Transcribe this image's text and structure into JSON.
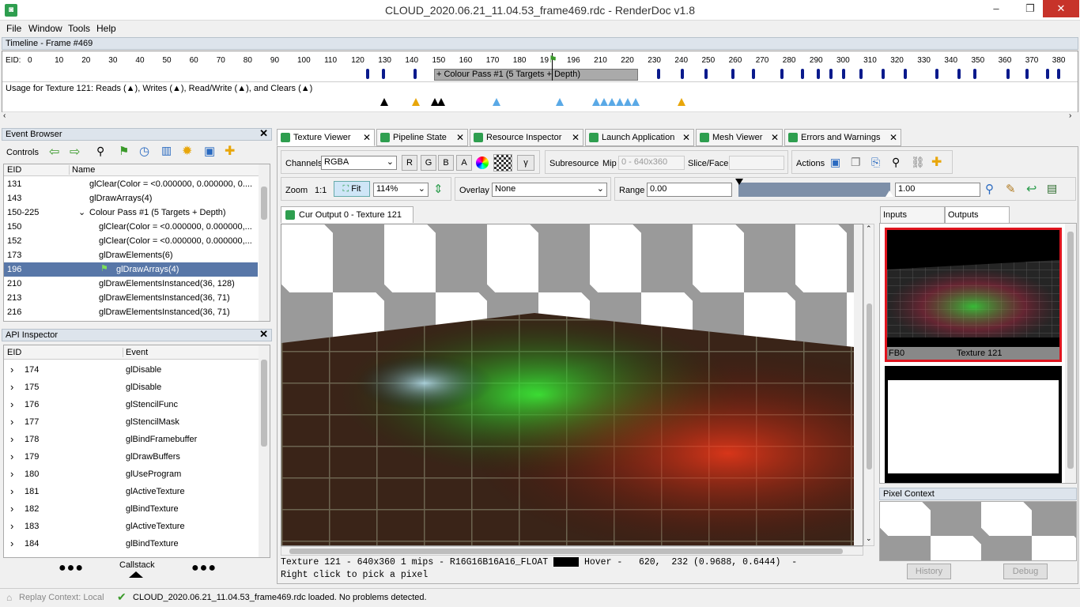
{
  "window": {
    "title": "CLOUD_2020.06.21_11.04.53_frame469.rdc - RenderDoc v1.8",
    "minimize": "–",
    "maximize": "❐",
    "close": "✕"
  },
  "menu": [
    "File",
    "Window",
    "Tools",
    "Help"
  ],
  "timeline": {
    "header": "Timeline - Frame #469",
    "eid_label": "EID:",
    "ticks": [
      "0",
      "10",
      "20",
      "30",
      "40",
      "50",
      "60",
      "70",
      "80",
      "90",
      "100",
      "110",
      "120",
      "130",
      "140",
      "150",
      "160",
      "170",
      "180",
      "19",
      "196",
      "210",
      "220",
      "230",
      "240",
      "250",
      "260",
      "270",
      "280",
      "290",
      "300",
      "310",
      "320",
      "330",
      "340",
      "350",
      "360",
      "370",
      "380"
    ],
    "pass_label": "+ Colour Pass #1 (5 Targets + Depth)",
    "usage_text": "Usage for Texture 121: Reads (▲), Writes (▲), Read/Write (▲), and Clears (▲)"
  },
  "event_browser": {
    "header": "Event Browser",
    "controls_label": "Controls",
    "columns": [
      "EID",
      "Name"
    ],
    "rows": [
      {
        "eid": "131",
        "name": "glClear(Color = <0.000000, 0.000000, 0...."
      },
      {
        "eid": "143",
        "name": "glDrawArrays(4)"
      },
      {
        "eid": "150-225",
        "name": "Colour Pass #1 (5 Targets + Depth)"
      },
      {
        "eid": "150",
        "name": "glClear(Color = <0.000000, 0.000000,..."
      },
      {
        "eid": "152",
        "name": "glClear(Color = <0.000000, 0.000000,..."
      },
      {
        "eid": "173",
        "name": "glDrawElements(6)"
      },
      {
        "eid": "196",
        "name": "glDrawArrays(4)"
      },
      {
        "eid": "210",
        "name": "glDrawElementsInstanced(36, 128)"
      },
      {
        "eid": "213",
        "name": "glDrawElementsInstanced(36, 71)"
      },
      {
        "eid": "216",
        "name": "glDrawElementsInstanced(36, 71)"
      }
    ]
  },
  "api_inspector": {
    "header": "API Inspector",
    "columns": [
      "EID",
      "Event"
    ],
    "rows": [
      {
        "eid": "174",
        "event": "glDisable"
      },
      {
        "eid": "175",
        "event": "glDisable"
      },
      {
        "eid": "176",
        "event": "glStencilFunc"
      },
      {
        "eid": "177",
        "event": "glStencilMask"
      },
      {
        "eid": "178",
        "event": "glBindFramebuffer"
      },
      {
        "eid": "179",
        "event": "glDrawBuffers"
      },
      {
        "eid": "180",
        "event": "glUseProgram"
      },
      {
        "eid": "181",
        "event": "glActiveTexture"
      },
      {
        "eid": "182",
        "event": "glBindTexture"
      },
      {
        "eid": "183",
        "event": "glActiveTexture"
      },
      {
        "eid": "184",
        "event": "glBindTexture"
      }
    ],
    "callstack_label": "Callstack"
  },
  "tabs": [
    "Texture Viewer",
    "Pipeline State",
    "Resource Inspector",
    "Launch Application",
    "Mesh Viewer",
    "Errors and Warnings"
  ],
  "texture_viewer": {
    "channels_label": "Channels",
    "channels_value": "RGBA",
    "channel_buttons": [
      "R",
      "G",
      "B",
      "A"
    ],
    "gamma": "γ",
    "subresource_label": "Subresource",
    "mip_label": "Mip",
    "mip_value": "0 - 640x360",
    "slice_label": "Slice/Face",
    "actions_label": "Actions",
    "zoom_label": "Zoom",
    "zoom_11": "1:1",
    "fit_label": "Fit",
    "zoom_value": "114%",
    "overlay_label": "Overlay",
    "overlay_value": "None",
    "range_label": "Range",
    "range_min": "0.00",
    "range_max": "1.00",
    "view_tab": "Cur Output 0 - Texture 121",
    "status_line1_a": "Texture 121 - 640x360 1 mips - R16G16B16A16_FLOAT",
    "status_line1_b": "Hover -   620,  232 (0.9688, 0.6444)  -",
    "status_line2": "Right click to pick a pixel",
    "side_tabs": [
      "Inputs",
      "Outputs"
    ],
    "thumb_fb": "FB0",
    "thumb_name": "Texture 121",
    "pixel_context_header": "Pixel Context",
    "history_btn": "History",
    "debug_btn": "Debug"
  },
  "statusbar": {
    "replay": "Replay Context: Local",
    "message": "CLOUD_2020.06.21_11.04.53_frame469.rdc loaded. No problems detected."
  },
  "colors": {
    "accent": "#2e9e4f",
    "selection": "#5877a8",
    "read": "#e8a60a",
    "write": "#5aa9e6",
    "clear": "#000000"
  }
}
